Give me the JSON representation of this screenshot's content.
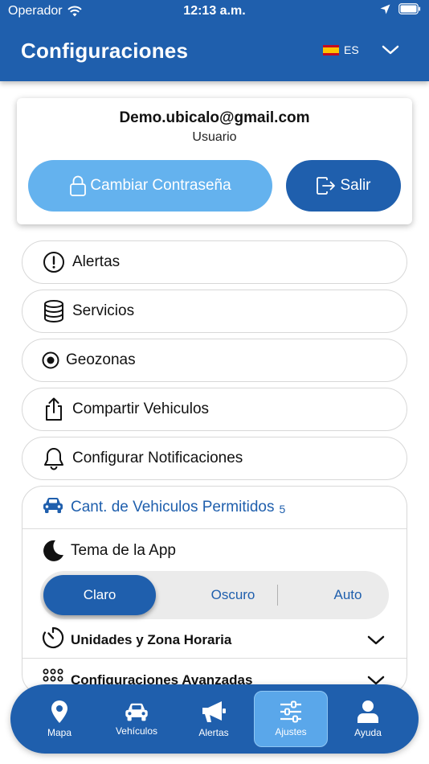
{
  "status_bar": {
    "carrier": "Operador",
    "time": "12:13 a.m."
  },
  "header": {
    "title": "Configuraciones",
    "language": "ES"
  },
  "user": {
    "email": "Demo.ubicalo@gmail.com",
    "role": "Usuario",
    "change_password_label": "Cambiar Contraseña",
    "logout_label": "Salir"
  },
  "menu": {
    "items": [
      {
        "label": "Alertas",
        "icon": "alert-circle-icon"
      },
      {
        "label": "Servicios",
        "icon": "database-icon"
      },
      {
        "label": "Geozonas",
        "icon": "radio-target-icon"
      },
      {
        "label": "Compartir Vehiculos",
        "icon": "share-icon"
      },
      {
        "label": "Configurar Notificaciones",
        "icon": "bell-icon"
      }
    ]
  },
  "settings": {
    "allowed_vehicles_label": "Cant. de Vehiculos Permitidos",
    "allowed_vehicles_count": "5",
    "theme_label": "Tema de la App",
    "theme_options": [
      "Claro",
      "Oscuro",
      "Auto"
    ],
    "theme_selected": "Claro",
    "units_label": "Unidades y Zona Horaria",
    "advanced_label": "Configuraciones Avanzadas"
  },
  "tabbar": {
    "tabs": [
      {
        "label": "Mapa",
        "icon": "map-pin-icon"
      },
      {
        "label": "Vehículos",
        "icon": "car-icon"
      },
      {
        "label": "Alertas",
        "icon": "megaphone-icon"
      },
      {
        "label": "Ajustes",
        "icon": "sliders-icon"
      },
      {
        "label": "Ayuda",
        "icon": "user-icon"
      }
    ],
    "active": "Ajustes"
  },
  "colors": {
    "primary": "#1f5fad",
    "light_button": "#64b2ee",
    "active_tab": "#5aa7ea"
  }
}
